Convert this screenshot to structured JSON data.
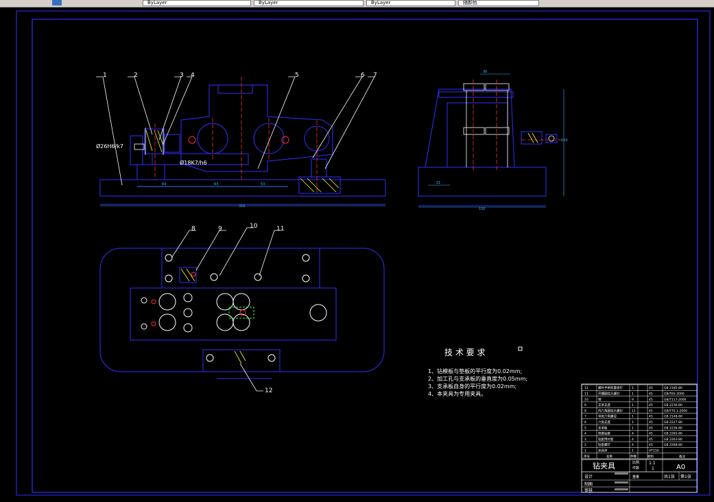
{
  "toolbar": {
    "segments": [
      "ByLayer",
      "ByLayer",
      "ByLayer",
      "随颜色"
    ]
  },
  "drawing": {
    "part_labels": [
      "1",
      "2",
      "3",
      "4",
      "5",
      "6",
      "7",
      "8",
      "9",
      "10",
      "11",
      "12"
    ],
    "dims": {
      "fit_d26": "Ø26H6/k7",
      "fit_18": "Ø18K7/h6",
      "d64": "64",
      "d63": "63",
      "d53": "53",
      "d316": "316",
      "d30": "30",
      "d21": "21",
      "d150": "150",
      "d150v": "150"
    },
    "tech_title": "技 术 要 求",
    "tech_lines": [
      "1、钻模板与垫板的平行度为0.02mm;",
      "2、加工孔与支承板的垂直度为0.05mm;",
      "3、支承板自身的平行度为0.02mm;",
      "4、本夹具为专用夹具。"
    ]
  },
  "bom": {
    "rows": [
      {
        "no": "12",
        "name": "螺杆手柄装置组钉",
        "qty": "1",
        "mat": "45",
        "std": "GB 2185-80"
      },
      {
        "no": "11",
        "name": "开槽圆柱头螺钉",
        "qty": "1",
        "mat": "45",
        "std": "GB/T65-2000"
      },
      {
        "no": "10",
        "name": "销",
        "qty": "9",
        "mat": "45",
        "std": "GB/T117-2000"
      },
      {
        "no": "9",
        "name": "支承支座",
        "qty": "1",
        "mat": "45",
        "std": "GB 2236-80"
      },
      {
        "no": "8",
        "name": "内六角圆柱头螺钉",
        "qty": "11",
        "mat": "45",
        "std": "GB/T70.1-2000"
      },
      {
        "no": "7",
        "name": "带肩六角螺母",
        "qty": "1",
        "mat": "45",
        "std": "GB 2148-80"
      },
      {
        "no": "6",
        "name": "六角支座",
        "qty": "1",
        "mat": "45",
        "std": "GB 2227-80"
      },
      {
        "no": "5",
        "name": "支承板",
        "qty": "1",
        "mat": "45",
        "std": "GB 2236-80"
      },
      {
        "no": "4",
        "name": "快换钻套",
        "qty": "4",
        "mat": "45",
        "std": "GB 2265-80"
      },
      {
        "no": "3",
        "name": "钻套用衬套",
        "qty": "4",
        "mat": "45",
        "std": "GB 2263-80"
      },
      {
        "no": "2",
        "name": "钻套螺钉",
        "qty": "4",
        "mat": "45",
        "std": "GB 2268-80"
      },
      {
        "no": "1",
        "name": "夹具体",
        "qty": "1",
        "mat": "HT150",
        "std": ""
      }
    ],
    "header": [
      "序号",
      "名称",
      "件数",
      "材料",
      "备注"
    ],
    "title": "钻夹具",
    "scale_label": "比例",
    "scale": "1:1",
    "qty_label": "件数",
    "qty": "1",
    "weight_label": "重量",
    "drawing_no": "A0",
    "sheets_total": "共1张",
    "sheet_no": "第1张",
    "design": "设计",
    "draw": "制图",
    "review": "审核"
  },
  "colors": {
    "background": "#000000",
    "outline": "#3030ff",
    "white": "#ffffff",
    "center": "#ff3030",
    "hatch": "#ffff30",
    "cyan": "#30c0ff",
    "green": "#30ff30"
  }
}
